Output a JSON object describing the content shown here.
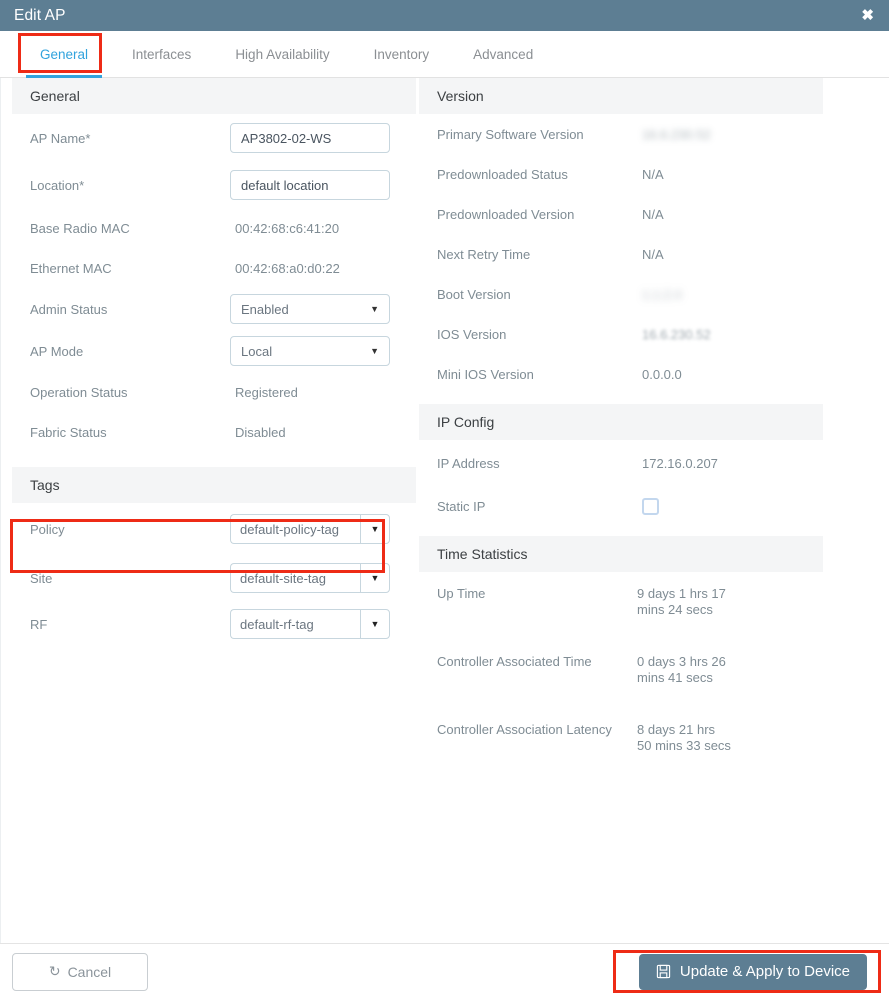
{
  "window": {
    "title": "Edit AP",
    "close_icon": "close-icon"
  },
  "tabs": [
    {
      "label": "General",
      "active": true
    },
    {
      "label": "Interfaces",
      "active": false
    },
    {
      "label": "High Availability",
      "active": false
    },
    {
      "label": "Inventory",
      "active": false
    },
    {
      "label": "Advanced",
      "active": false
    }
  ],
  "left": {
    "general": {
      "header": "General",
      "ap_name_label": "AP Name*",
      "ap_name_value": "AP3802-02-WS",
      "location_label": "Location*",
      "location_value": "default location",
      "base_radio_mac_label": "Base Radio MAC",
      "base_radio_mac_value": "00:42:68:c6:41:20",
      "ethernet_mac_label": "Ethernet MAC",
      "ethernet_mac_value": "00:42:68:a0:d0:22",
      "admin_status_label": "Admin Status",
      "admin_status_value": "Enabled",
      "ap_mode_label": "AP Mode",
      "ap_mode_value": "Local",
      "operation_status_label": "Operation Status",
      "operation_status_value": "Registered",
      "fabric_status_label": "Fabric Status",
      "fabric_status_value": "Disabled"
    },
    "tags": {
      "header": "Tags",
      "policy_label": "Policy",
      "policy_value": "default-policy-tag",
      "site_label": "Site",
      "site_value": "default-site-tag",
      "rf_label": "RF",
      "rf_value": "default-rf-tag"
    }
  },
  "right": {
    "version": {
      "header": "Version",
      "primary_software_label": "Primary Software Version",
      "primary_software_value": "16.6.230.52",
      "predownloaded_status_label": "Predownloaded Status",
      "predownloaded_status_value": "N/A",
      "predownloaded_version_label": "Predownloaded Version",
      "predownloaded_version_value": "N/A",
      "next_retry_label": "Next Retry Time",
      "next_retry_value": "N/A",
      "boot_version_label": "Boot Version",
      "boot_version_value": "1.1.2.4",
      "ios_version_label": "IOS Version",
      "ios_version_value": "16.6.230.52",
      "mini_ios_label": "Mini IOS Version",
      "mini_ios_value": "0.0.0.0"
    },
    "ip_config": {
      "header": "IP Config",
      "ip_address_label": "IP Address",
      "ip_address_value": "172.16.0.207",
      "static_ip_label": "Static IP",
      "static_ip_checked": false
    },
    "time_statistics": {
      "header": "Time Statistics",
      "up_time_label": "Up Time",
      "up_time_value": "9 days 1 hrs 17 mins 24 secs",
      "controller_associated_label": "Controller Associated Time",
      "controller_associated_value": "0 days 3 hrs 26 mins 41 secs",
      "controller_latency_label": "Controller Association Latency",
      "controller_latency_value": "8 days 21 hrs 50 mins 33 secs"
    }
  },
  "footer": {
    "cancel_label": "Cancel",
    "cancel_icon": "undo-icon",
    "update_label": "Update & Apply to Device",
    "update_icon": "save-icon"
  },
  "colors": {
    "header_bar": "#5d7e93",
    "active_tab": "#31a3dd",
    "annotation": "#ee2b16",
    "primary_button": "#5d7e93"
  }
}
